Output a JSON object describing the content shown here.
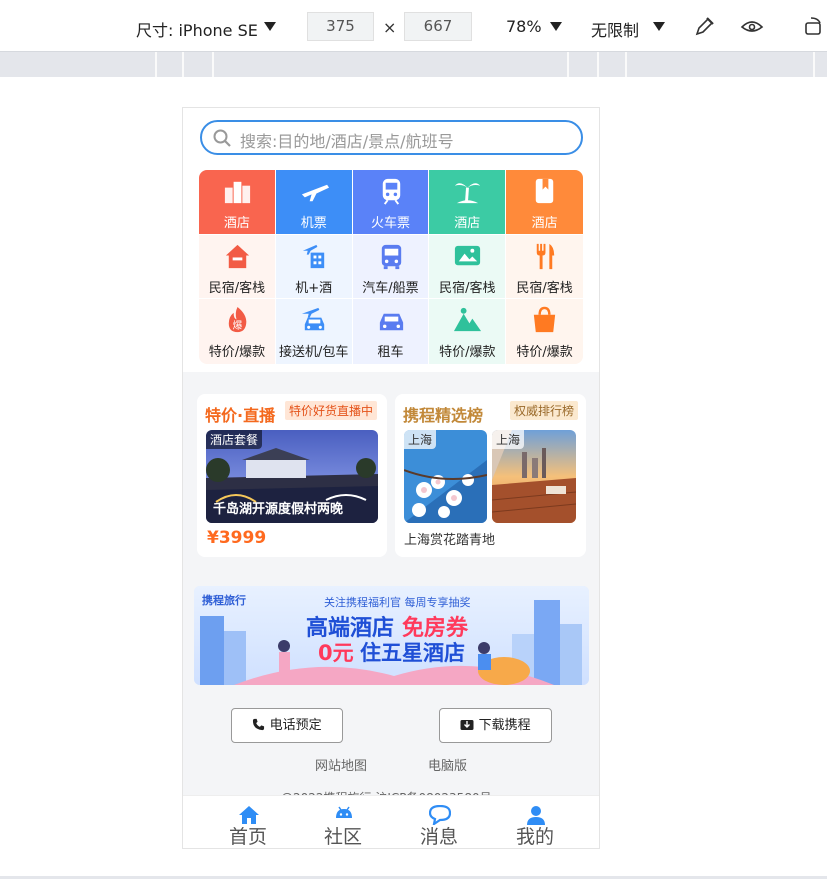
{
  "devtools": {
    "size_label": "尺寸: iPhone SE",
    "width_value": "375",
    "times_symbol": "×",
    "height_value": "667",
    "zoom_label": "78%",
    "throttle_label": "无限制"
  },
  "search": {
    "placeholder": "搜索:目的地/酒店/景点/航班号"
  },
  "grid": {
    "top_row": [
      {
        "label": "酒店",
        "icon": "hotel-building-icon",
        "color": "#f9654f"
      },
      {
        "label": "机票",
        "icon": "airplane-icon",
        "color": "#3d8ef7"
      },
      {
        "label": "火车票",
        "icon": "train-icon",
        "color": "#5a82f8"
      },
      {
        "label": "酒店",
        "icon": "palm-tree-icon",
        "color": "#3ccba4"
      },
      {
        "label": "酒店",
        "icon": "guide-book-icon",
        "color": "#ff8a3a"
      }
    ],
    "row2": [
      {
        "label": "民宿/客栈",
        "icon": "house-icon"
      },
      {
        "label": "机+酒",
        "icon": "flight-hotel-icon"
      },
      {
        "label": "汽车/船票",
        "icon": "bus-icon"
      },
      {
        "label": "民宿/客栈",
        "icon": "picture-icon"
      },
      {
        "label": "民宿/客栈",
        "icon": "fork-knife-icon"
      }
    ],
    "row3": [
      {
        "label": "特价/爆款",
        "icon": "hot-deal-icon"
      },
      {
        "label": "接送机/包车",
        "icon": "airport-car-icon"
      },
      {
        "label": "租车",
        "icon": "car-icon"
      },
      {
        "label": "特价/爆款",
        "icon": "mountain-icon"
      },
      {
        "label": "特价/爆款",
        "icon": "bag-icon"
      }
    ]
  },
  "deal_card": {
    "title": "特价·直播",
    "tag": "特价好货直播中",
    "badge": "酒店套餐",
    "caption": "千岛湖开源度假村两晚",
    "price": "¥3999"
  },
  "rank_card": {
    "title": "携程精选榜",
    "tag": "权威排行榜",
    "badge_left": "上海",
    "badge_right": "上海",
    "caption": "上海赏花踏青地"
  },
  "banner": {
    "logo": "携程旅行",
    "subtitle": "关注携程福利官 每周专享抽奖",
    "line1_a": "高端酒店",
    "line1_b": "免房券",
    "line2_a": "0元",
    "line2_b": "住五星酒店"
  },
  "footer": {
    "phone_button": "电话预定",
    "download_button": "下载携程",
    "sitemap": "网站地图",
    "pc_version": "电脑版",
    "copyright": "@2022携程旅行 沪ICP备08023580号"
  },
  "tabbar": [
    {
      "label": "首页",
      "icon": "home-icon"
    },
    {
      "label": "社区",
      "icon": "android-icon"
    },
    {
      "label": "消息",
      "icon": "chat-bubble-icon"
    },
    {
      "label": "我的",
      "icon": "person-icon"
    }
  ]
}
